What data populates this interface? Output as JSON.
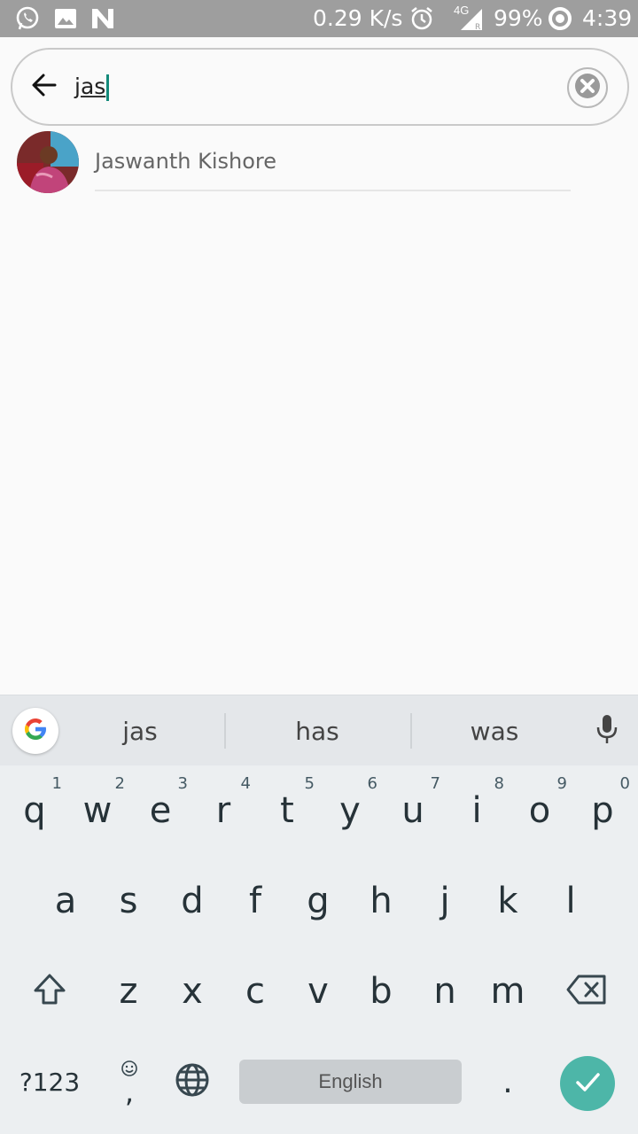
{
  "status_bar": {
    "network_speed": "0.29 K/s",
    "network_type": "4G",
    "battery": "99%",
    "time": "4:39",
    "icons": [
      "whatsapp-icon",
      "gallery-icon",
      "n-app-icon",
      "alarm-icon",
      "signal-icon",
      "battery-ring-icon"
    ]
  },
  "search": {
    "value": "jas",
    "back_icon": "arrow-back-icon",
    "clear_icon": "clear-icon"
  },
  "results": [
    {
      "name": "Jaswanth Kishore"
    }
  ],
  "keyboard": {
    "suggestions": [
      "jas",
      "has",
      "was"
    ],
    "row1": [
      {
        "key": "q",
        "hint": "1"
      },
      {
        "key": "w",
        "hint": "2"
      },
      {
        "key": "e",
        "hint": "3"
      },
      {
        "key": "r",
        "hint": "4"
      },
      {
        "key": "t",
        "hint": "5"
      },
      {
        "key": "y",
        "hint": "6"
      },
      {
        "key": "u",
        "hint": "7"
      },
      {
        "key": "i",
        "hint": "8"
      },
      {
        "key": "o",
        "hint": "9"
      },
      {
        "key": "p",
        "hint": "0"
      }
    ],
    "row2": [
      "a",
      "s",
      "d",
      "f",
      "g",
      "h",
      "j",
      "k",
      "l"
    ],
    "row3": [
      "z",
      "x",
      "c",
      "v",
      "b",
      "n",
      "m"
    ],
    "symbols_label": "?123",
    "comma_label": ",",
    "period_label": ".",
    "space_label": "English",
    "accent_color": "#4db6a8"
  }
}
